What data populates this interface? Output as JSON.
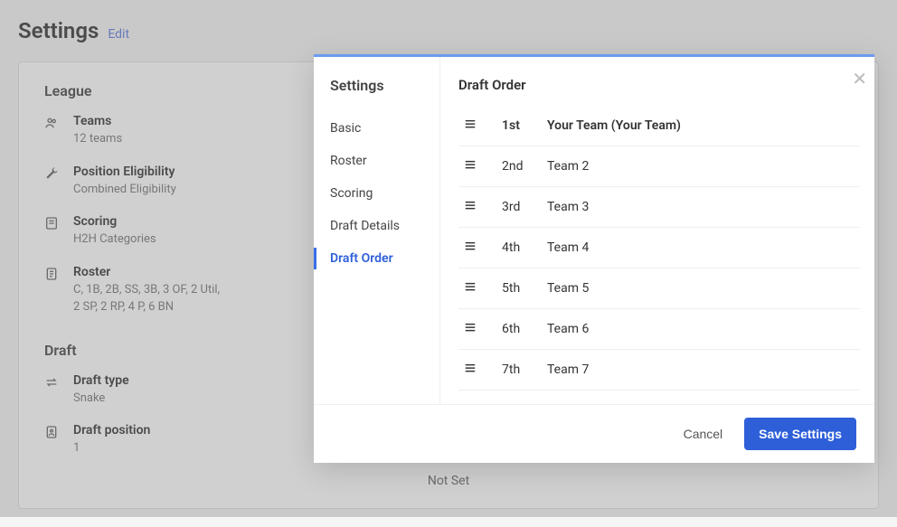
{
  "page": {
    "title": "Settings",
    "edit": "Edit"
  },
  "league": {
    "heading": "League",
    "teams_label": "Teams",
    "teams_value": "12 teams",
    "pos_label": "Position Eligibility",
    "pos_value": "Combined Eligibility",
    "scoring_label": "Scoring",
    "scoring_value": "H2H Categories",
    "roster_label": "Roster",
    "roster_value1": "C, 1B, 2B, SS, 3B, 3 OF, 2 Util,",
    "roster_value2": "2 SP, 2 RP, 4 P, 6 BN"
  },
  "draft": {
    "heading": "Draft",
    "type_label": "Draft type",
    "type_value": "Snake",
    "pos_label": "Draft position",
    "pos_value": "1",
    "not_set": "Not Set"
  },
  "modal": {
    "sidebar_title": "Settings",
    "tabs": {
      "basic": "Basic",
      "roster": "Roster",
      "scoring": "Scoring",
      "details": "Draft Details",
      "order": "Draft Order"
    },
    "main_title": "Draft Order",
    "rows": [
      {
        "pos": "1st",
        "team": "Your Team (Your Team)"
      },
      {
        "pos": "2nd",
        "team": "Team 2"
      },
      {
        "pos": "3rd",
        "team": "Team 3"
      },
      {
        "pos": "4th",
        "team": "Team 4"
      },
      {
        "pos": "5th",
        "team": "Team 5"
      },
      {
        "pos": "6th",
        "team": "Team 6"
      },
      {
        "pos": "7th",
        "team": "Team 7"
      }
    ],
    "cancel": "Cancel",
    "save": "Save Settings"
  }
}
